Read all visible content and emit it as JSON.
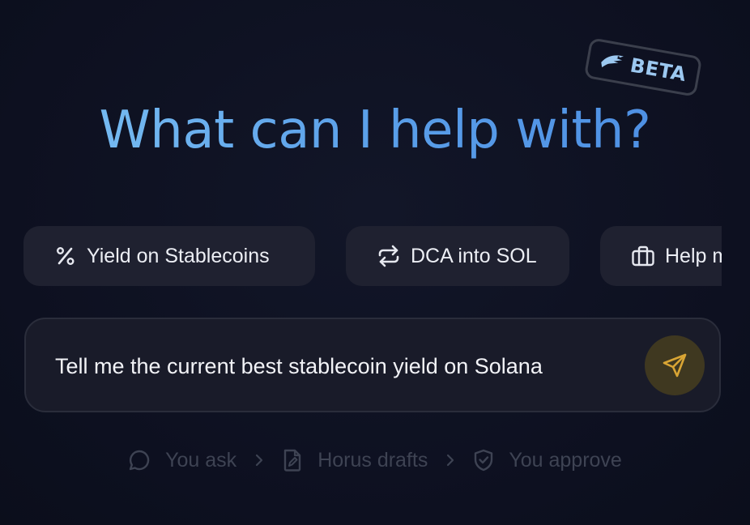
{
  "badge": {
    "label": "BETA",
    "icon": "horus-bird-icon"
  },
  "headline": "What can I help with?",
  "suggestions": [
    {
      "label": "Yield on Stablecoins",
      "icon": "percent-icon"
    },
    {
      "label": "DCA into SOL",
      "icon": "repeat-arrows-icon"
    },
    {
      "label": "Help m",
      "icon": "briefcase-icon"
    }
  ],
  "composer": {
    "value": "Tell me the current best stablecoin yield on Solana",
    "send_icon": "send-icon"
  },
  "steps": [
    {
      "label": "You ask",
      "icon": "chat-bubble-icon"
    },
    {
      "label": "Horus drafts",
      "icon": "draft-document-icon"
    },
    {
      "label": "You approve",
      "icon": "shield-check-icon"
    }
  ],
  "colors": {
    "background": "#0e1120",
    "headline_gradient_start": "#7ec3f4",
    "headline_gradient_end": "#4a8be2",
    "chip_background": "#1f2130",
    "send_button": "#3f3820",
    "send_icon": "#d9a534",
    "step_text": "#3e4353"
  }
}
